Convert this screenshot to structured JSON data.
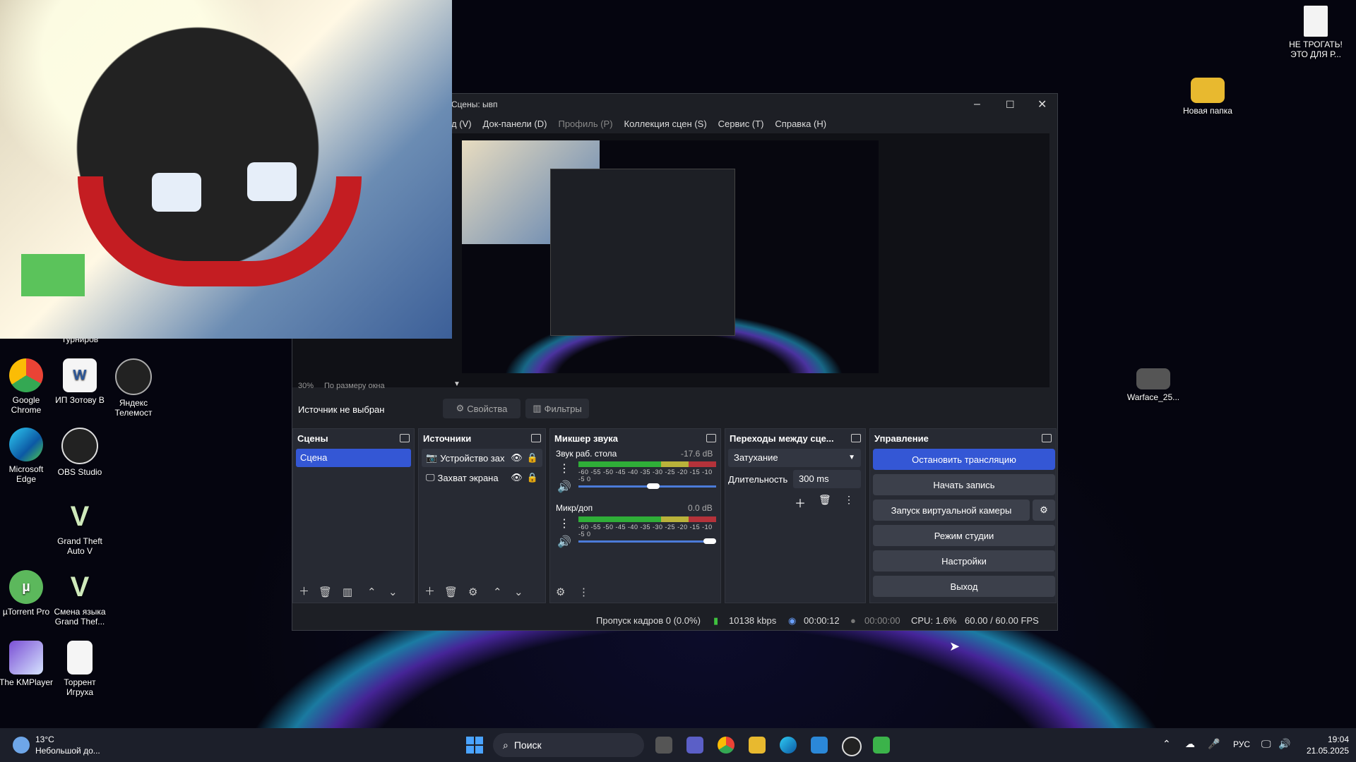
{
  "desktop": {
    "top_right_file": "НЕ ТРОГАТЬ! ЭТО ДЛЯ Р...",
    "new_folder": "Новая папка",
    "warface": "Warface_25...",
    "icons": [
      {
        "label": "Турниров"
      },
      {
        "label": "Google Chrome"
      },
      {
        "label": "ИП Зотову В"
      },
      {
        "label": "Яндекс Телемост"
      },
      {
        "label": "Microsoft Edge"
      },
      {
        "label": "OBS Studio"
      },
      {
        "label": "Grand Theft Auto V"
      },
      {
        "label": "µTorrent Pro"
      },
      {
        "label": "Смена языка Grand Thef..."
      },
      {
        "label": "The KMPlayer"
      },
      {
        "label": "Торрент Игруха"
      }
    ]
  },
  "obs": {
    "title": "Сцены: ывп",
    "menu": [
      "д (V)",
      "Док-панели (D)",
      "Профиль (P)",
      "Коллекция сцен (S)",
      "Сервис (T)",
      "Справка (H)"
    ],
    "zoom": "30%",
    "zoom_mode": "По размеру окна",
    "no_source": "Источник не выбран",
    "properties": "Свойства",
    "filters": "Фильтры",
    "scenes": {
      "title": "Сцены",
      "items": [
        "Сцена"
      ]
    },
    "sources": {
      "title": "Источники",
      "items": [
        "Устройство зах",
        "Захват экрана"
      ]
    },
    "mixer": {
      "title": "Микшер звука",
      "channels": [
        {
          "name": "Звук раб. стола",
          "db": "-17.6 dB",
          "volume": 0.55
        },
        {
          "name": "Микр/доп",
          "db": "0.0 dB",
          "volume": 1.0
        }
      ],
      "ticks": "-60 -55 -50 -45 -40 -35 -30 -25 -20 -15 -10 -5 0"
    },
    "transitions": {
      "title": "Переходы между сце...",
      "selected": "Затухание",
      "duration_label": "Длительность",
      "duration": "300 ms"
    },
    "controls": {
      "title": "Управление",
      "stop_stream": "Остановить трансляцию",
      "start_record": "Начать запись",
      "virtual_cam": "Запуск виртуальной камеры",
      "studio": "Режим студии",
      "settings": "Настройки",
      "exit": "Выход"
    },
    "status": {
      "dropped": "Пропуск кадров 0 (0.0%)",
      "bitrate": "10138 kbps",
      "stream_time": "00:00:12",
      "rec_time": "00:00:00",
      "cpu": "CPU: 1.6%",
      "fps": "60.00 / 60.00 FPS"
    }
  },
  "taskbar": {
    "weather_temp": "13°C",
    "weather_desc": "Небольшой до...",
    "search": "Поиск",
    "lang": "РУС",
    "time": "19:04",
    "date": "21.05.2025"
  },
  "colors": {
    "accent": "#3457d5",
    "panel": "#272a33",
    "window": "#1d1f25"
  }
}
